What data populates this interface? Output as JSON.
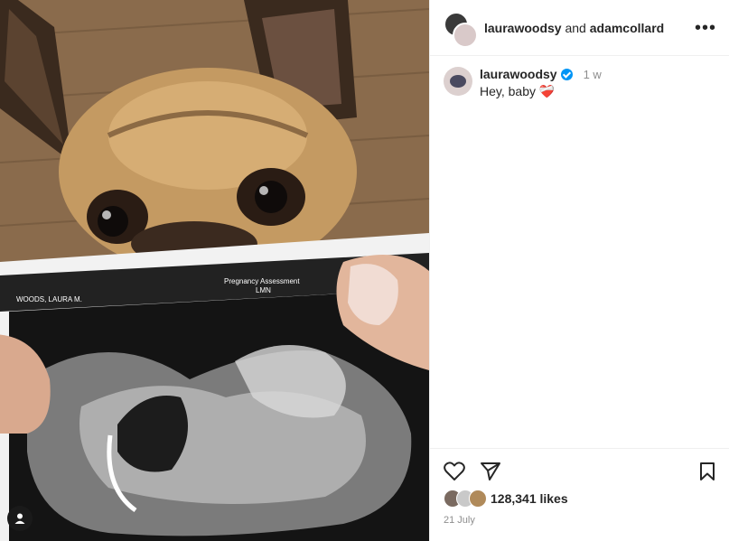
{
  "header": {
    "user1": "laurawoodsy",
    "joiner": "and",
    "user2": "adamcollard",
    "more_label": "•••"
  },
  "caption": {
    "username": "laurawoodsy",
    "time": "1 w",
    "text": "Hey, baby",
    "emoji": "❤️‍🩹"
  },
  "photo": {
    "scan_name": "WOODS, LAURA  M.",
    "scan_title": "Pregnancy Assessment",
    "scan_sub": "LMN"
  },
  "footer": {
    "likes": "128,341 likes",
    "date": "21 July",
    "liker_colors": [
      "#7a6a60",
      "#c9c9c9",
      "#b08a5a"
    ]
  },
  "icons": {
    "like": "heart-icon",
    "share": "send-icon",
    "save": "bookmark-icon",
    "tag": "user-tag-icon"
  },
  "colors": {
    "verified": "#0095f6",
    "muted": "#8e8e8e",
    "text": "#262626"
  }
}
